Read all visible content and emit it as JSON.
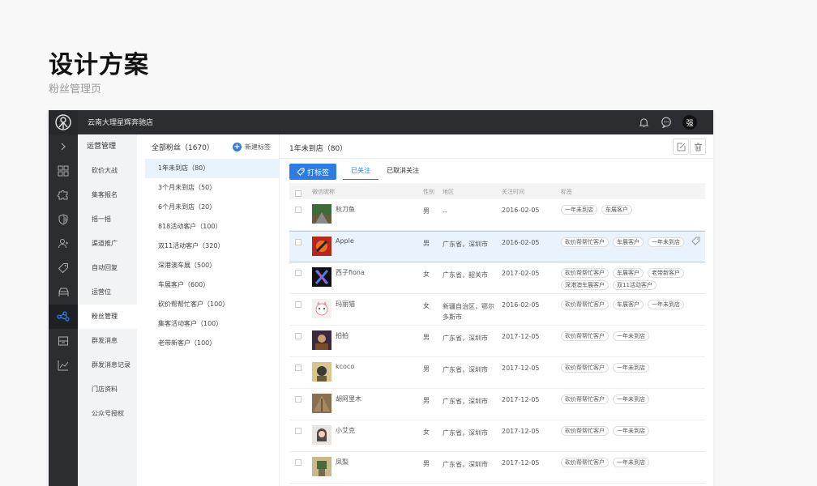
{
  "page": {
    "title": "设计方案",
    "subtitle": "粉丝管理页"
  },
  "topbar": {
    "store_name": "云南大理星辉奔驰店",
    "user_initial": "强"
  },
  "menu": {
    "heading": "运营管理",
    "items": [
      "砍价大战",
      "集客报名",
      "摇一摇",
      "渠道推广",
      "自动回复",
      "运营位",
      "粉丝管理",
      "群发消息",
      "群发消息记录",
      "门店资料",
      "公众号授权"
    ]
  },
  "groups": {
    "title": "全部粉丝（1670）",
    "new_label": "新建标签",
    "items": [
      "1年未到店（80）",
      "3个月未到店（50）",
      "6个月未到店（20）",
      "818活动客户（100）",
      "双11活动客户（320）",
      "深港澳车展（500）",
      "车展客户（600）",
      "砍价帮帮忙客户（100）",
      "集客活动客户（100）",
      "老带新客户（100）"
    ]
  },
  "main": {
    "title": "1年未到店（80）",
    "tag_button": "打标签",
    "tabs": [
      "已关注",
      "已取消关注"
    ],
    "columns": {
      "name": "微信昵称",
      "gender": "性别",
      "region": "地区",
      "time": "关注时间",
      "tags": "标签"
    },
    "rows": [
      {
        "name": "秋刀鱼",
        "gender": "男",
        "region": "--",
        "time": "2016-02-05",
        "tags": [
          "一年未到店",
          "车展客户"
        ]
      },
      {
        "name": "Apple",
        "gender": "男",
        "region": "广东省，深圳市",
        "time": "2016-02-05",
        "tags": [
          "砍价帮帮忙客户",
          "车展客户",
          "一年未到店"
        ]
      },
      {
        "name": "西子fiona",
        "gender": "女",
        "region": "广东省，韶关市",
        "time": "2017-02-05",
        "tags": [
          "砍价帮帮忙客户",
          "车展客户",
          "老带新客户",
          "深港澳车展客户",
          "双11活动客户"
        ]
      },
      {
        "name": "玛丽猫",
        "gender": "女",
        "region": "新疆自治区，鄂尔多斯市",
        "time": "2016-02-05",
        "tags": [
          "砍价帮帮忙客户",
          "车展客户",
          "一年未到店"
        ]
      },
      {
        "name": "拍拍",
        "gender": "男",
        "region": "广东省，深圳市",
        "time": "2017-12-05",
        "tags": [
          "砍价帮帮忙客户",
          "一年未到店"
        ]
      },
      {
        "name": "kcoco",
        "gender": "男",
        "region": "广东省，深圳市",
        "time": "2017-12-05",
        "tags": [
          "砍价帮帮忙客户",
          "一年未到店"
        ]
      },
      {
        "name": "胡阿里木",
        "gender": "男",
        "region": "广东省，深圳市",
        "time": "2017-12-05",
        "tags": [
          "砍价帮帮忙客户",
          "一年未到店"
        ]
      },
      {
        "name": "小艾克",
        "gender": "女",
        "region": "广东省，深圳市",
        "time": "2017-12-05",
        "tags": [
          "砍价帮帮忙客户",
          "一年未到店"
        ]
      },
      {
        "name": "凤梨",
        "gender": "男",
        "region": "广东省，深圳市",
        "time": "2017-12-05",
        "tags": [
          "砍价帮帮忙客户",
          "一年未到店"
        ]
      }
    ]
  },
  "colors": {
    "accent": "#2d7be5",
    "sidebar_dark": "#2b2d31",
    "row_highlight": "#e8f3fd"
  }
}
